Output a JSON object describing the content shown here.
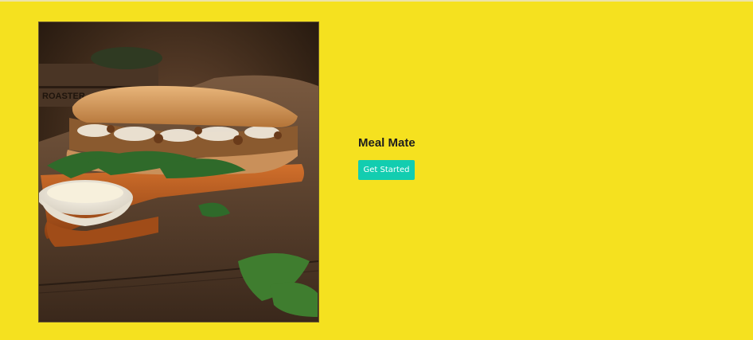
{
  "hero": {
    "title": "Meal Mate",
    "cta_label": "Get Started",
    "image_name": "sandwich-photo",
    "image_lettering": "ROASTER"
  },
  "colors": {
    "background": "#f5e11f",
    "button": "#12cdb0",
    "button_text": "#ffffff",
    "title_text": "#1e1e1e"
  }
}
